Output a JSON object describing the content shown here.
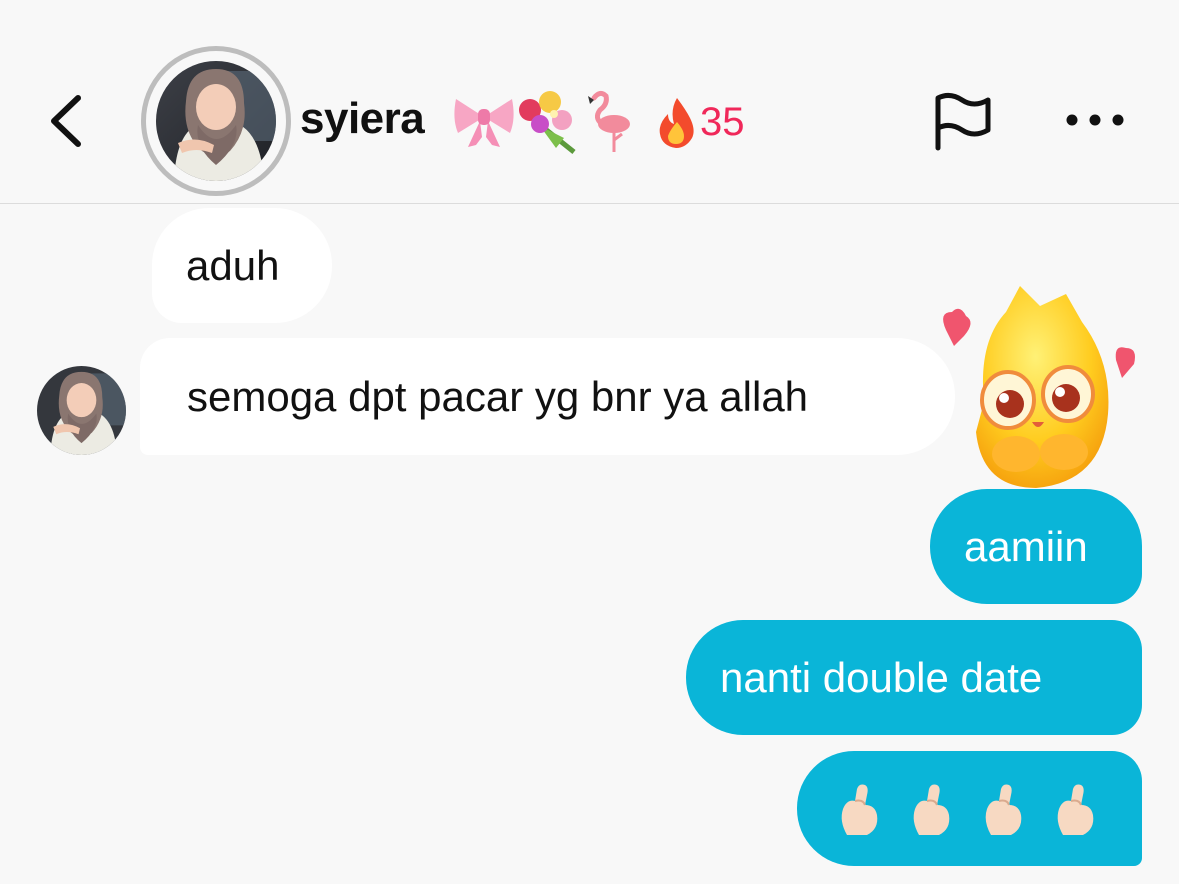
{
  "header": {
    "back_icon": "chevron-left-icon",
    "username": "syiera",
    "name_emojis": [
      "ribbon",
      "bouquet",
      "flamingo"
    ],
    "streak_icon": "fire",
    "streak_count": "35",
    "flag_icon": "flag-icon",
    "more_icon": "more-horizontal-icon"
  },
  "messages": [
    {
      "direction": "incoming",
      "text": "aduh"
    },
    {
      "direction": "incoming",
      "text": "semoga dpt pacar yg bnr ya allah",
      "reaction_sticker": "blushing-yellow-creature-with-hearts"
    },
    {
      "direction": "outgoing",
      "text": "aamiin"
    },
    {
      "direction": "outgoing",
      "text": "nanti double date"
    },
    {
      "direction": "outgoing",
      "emoji": "finger-heart",
      "emoji_count": 4
    }
  ],
  "colors": {
    "background": "#f8f8f8",
    "incoming_bubble": "#ffffff",
    "outgoing_bubble": "#0ab5d8",
    "outgoing_text": "#ffffff",
    "streak_text": "#f0285a",
    "divider": "#dcdcdc"
  }
}
